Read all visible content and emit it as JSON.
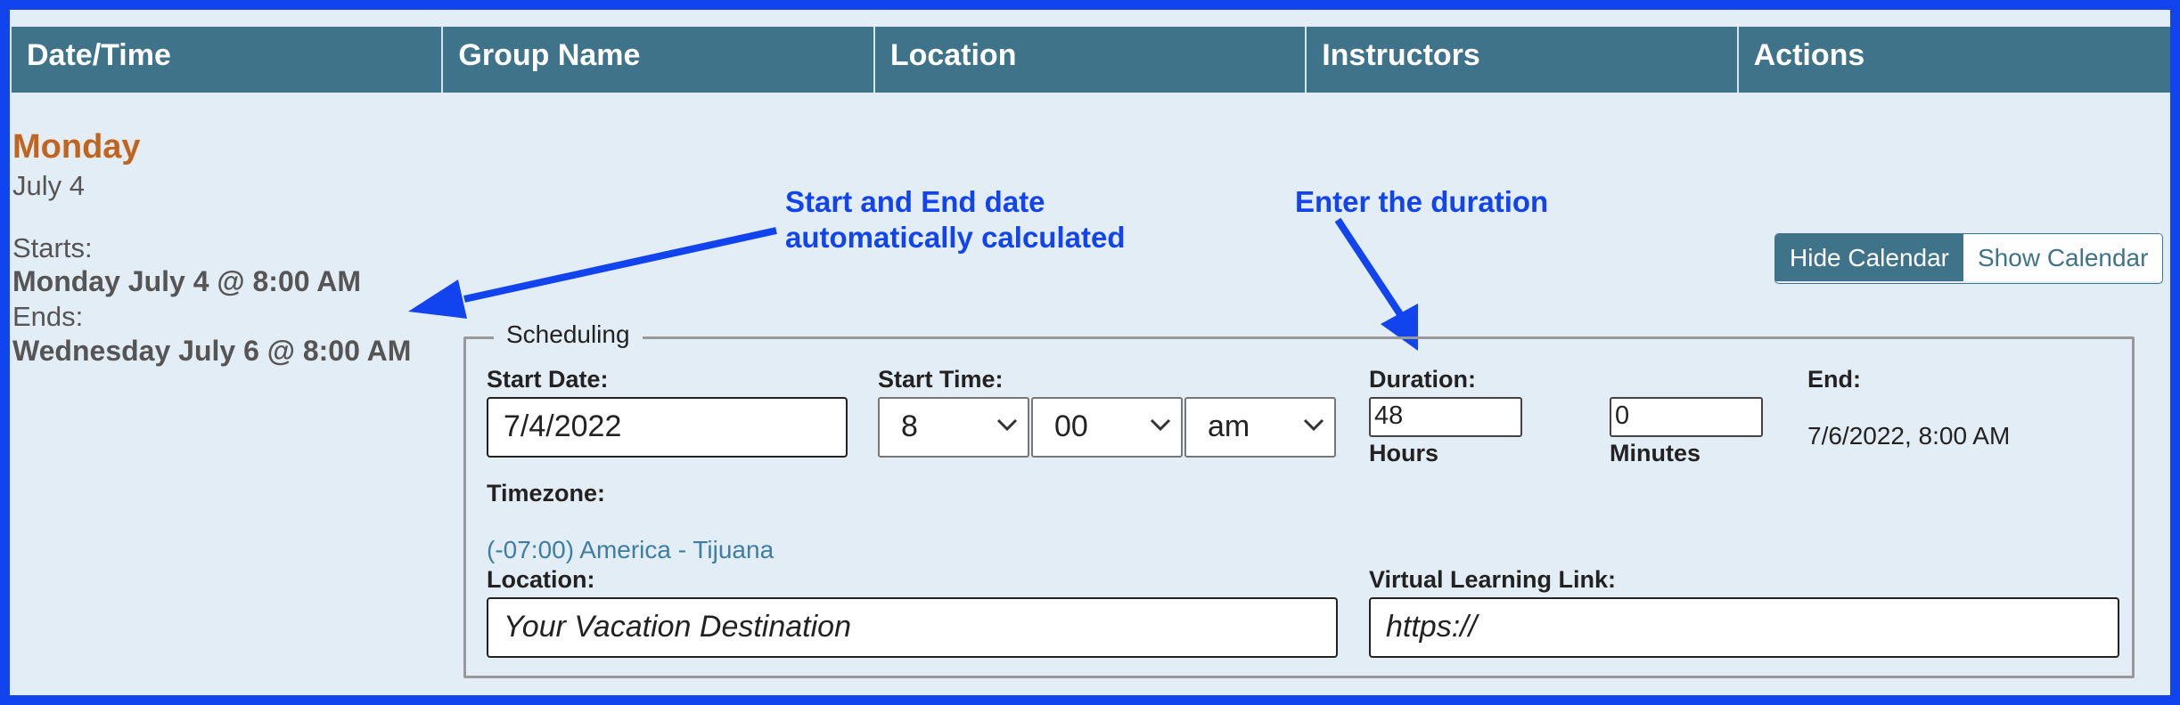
{
  "table": {
    "headers": [
      "Date/Time",
      "Group Name",
      "Location",
      "Instructors",
      "Actions"
    ]
  },
  "session": {
    "day": "Monday",
    "date": "July 4",
    "starts_label": "Starts:",
    "starts_value": "Monday July 4 @ 8:00 AM",
    "ends_label": "Ends:",
    "ends_value": "Wednesday July 6 @ 8:00 AM"
  },
  "annotations": {
    "dates_note": "Start and End date automatically calculated",
    "duration_note": "Enter the duration",
    "color": "#1144ee"
  },
  "calendar_toggle": {
    "hide_label": "Hide Calendar",
    "show_label": "Show Calendar",
    "active": "hide"
  },
  "scheduling": {
    "legend": "Scheduling",
    "start_date_label": "Start Date:",
    "start_date_value": "7/4/2022",
    "start_time_label": "Start Time:",
    "hour": "8",
    "minute": "00",
    "ampm": "am",
    "duration_label": "Duration:",
    "hours_value": "48",
    "hours_label": "Hours",
    "minutes_value": "0",
    "minutes_label": "Minutes",
    "end_label": "End:",
    "end_value": "7/6/2022, 8:00 AM",
    "timezone_label": "Timezone:",
    "timezone_value": "(-07:00) America - Tijuana",
    "location_label": "Location:",
    "location_value": "Your Vacation Destination",
    "virtual_link_label": "Virtual Learning Link:",
    "virtual_link_value": "https://"
  },
  "colors": {
    "header_bg": "#3f7389",
    "frame_border": "#1144ee",
    "day_color": "#c0641f",
    "panel_bg": "#e3edf5"
  }
}
